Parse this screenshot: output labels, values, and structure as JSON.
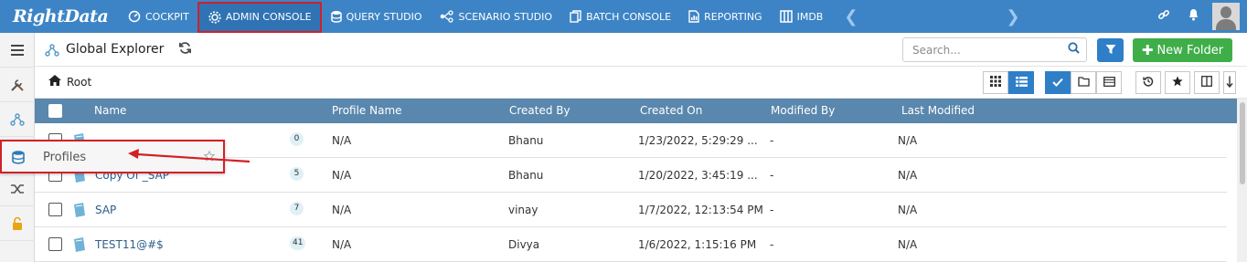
{
  "topbar": {
    "logo": "RightData",
    "nav": [
      {
        "label": "COCKPIT",
        "icon": "gauge-icon"
      },
      {
        "label": "ADMIN CONSOLE",
        "icon": "gear-icon",
        "active": true
      },
      {
        "label": "QUERY STUDIO",
        "icon": "database-icon"
      },
      {
        "label": "SCENARIO STUDIO",
        "icon": "sitemap-icon"
      },
      {
        "label": "BATCH CONSOLE",
        "icon": "copy-icon"
      },
      {
        "label": "REPORTING",
        "icon": "report-icon"
      },
      {
        "label": "IMDB",
        "icon": "columns-icon"
      }
    ]
  },
  "header": {
    "title": "Global Explorer",
    "search_placeholder": "Search...",
    "new_folder_label": "New Folder"
  },
  "breadcrumb": {
    "root": "Root"
  },
  "table": {
    "columns": [
      "Name",
      "Profile Name",
      "Created By",
      "Created On",
      "Modified By",
      "Last Modified"
    ],
    "rows": [
      {
        "name": "",
        "count": "0",
        "profile": "N/A",
        "created_by": "Bhanu",
        "created_on": "1/23/2022, 5:29:29 ...",
        "modified_by": "-",
        "last_modified": "N/A"
      },
      {
        "name": "Copy Of _SAP",
        "count": "5",
        "profile": "N/A",
        "created_by": "Bhanu",
        "created_on": "1/20/2022, 3:45:19 ...",
        "modified_by": "-",
        "last_modified": "N/A"
      },
      {
        "name": "SAP",
        "count": "7",
        "profile": "N/A",
        "created_by": "vinay",
        "created_on": "1/7/2022, 12:13:54 PM",
        "modified_by": "-",
        "last_modified": "N/A"
      },
      {
        "name": "TEST11@#$",
        "count": "41",
        "profile": "N/A",
        "created_by": "Divya",
        "created_on": "1/6/2022, 1:15:16 PM",
        "modified_by": "-",
        "last_modified": "N/A"
      }
    ]
  },
  "popup": {
    "label": "Profiles"
  },
  "colors": {
    "topbar": "#3d84c6",
    "highlight": "#d32027",
    "table_header": "#5a87ad",
    "new_folder": "#3fae49"
  }
}
